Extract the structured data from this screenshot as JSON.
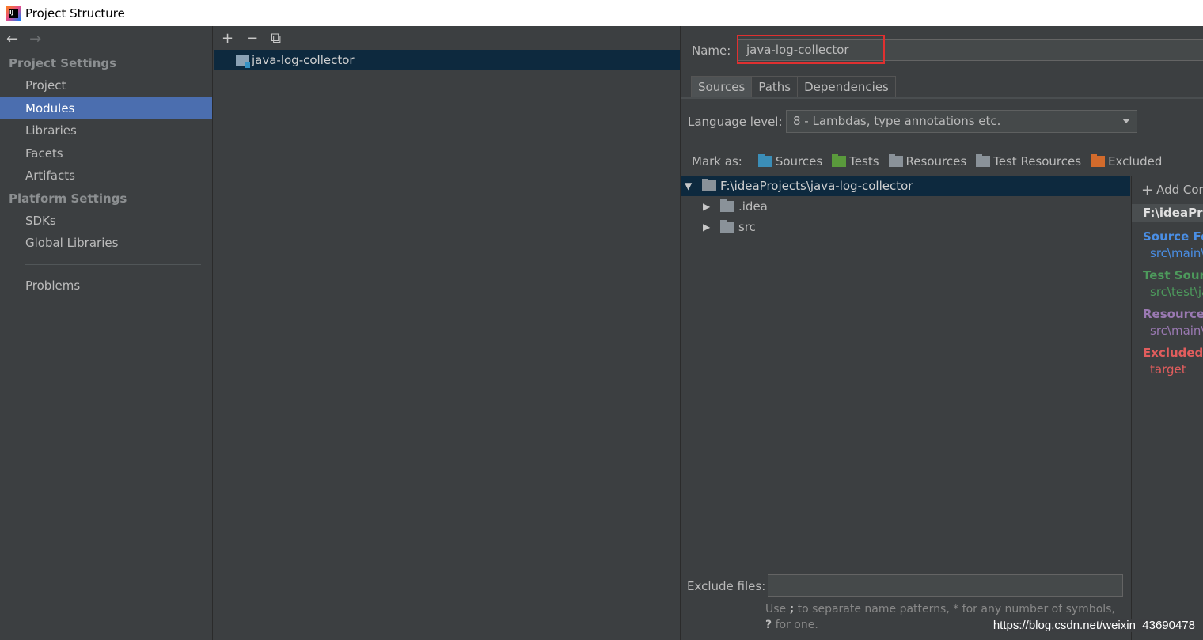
{
  "window": {
    "title": "Project Structure",
    "app_icon": "intellij-icon"
  },
  "sidebar": {
    "back_icon": "←",
    "forward_icon": "→",
    "project_settings_header": "Project Settings",
    "project_items": [
      "Project",
      "Modules",
      "Libraries",
      "Facets",
      "Artifacts"
    ],
    "selected": "Modules",
    "platform_settings_header": "Platform Settings",
    "platform_items": [
      "SDKs",
      "Global Libraries"
    ],
    "problems": "Problems"
  },
  "module_list": {
    "toolbar": {
      "add": "+",
      "remove": "−",
      "copy": "⧉"
    },
    "modules": [
      "java-log-collector"
    ]
  },
  "module_detail": {
    "name_label": "Name:",
    "name_value": "java-log-collector",
    "tabs": [
      "Sources",
      "Paths",
      "Dependencies"
    ],
    "active_tab": "Sources",
    "language_level_label": "Language level:",
    "language_level_value": "8 - Lambdas, type annotations etc.",
    "mark_as_label": "Mark as:",
    "mark_as": [
      {
        "label": "Sources",
        "color": "#3b8eb8"
      },
      {
        "label": "Tests",
        "color": "#5a9a3c"
      },
      {
        "label": "Resources",
        "color": "#8a9299"
      },
      {
        "label": "Test Resources",
        "color": "#8a9299"
      },
      {
        "label": "Excluded",
        "color": "#d36b2c"
      }
    ],
    "tree": {
      "root": "F:\\ideaProjects\\java-log-collector",
      "children": [
        ".idea",
        "src"
      ]
    },
    "content_roots": {
      "add_label": "Add Content Root",
      "root_path": "F:\\ideaProjects\\java-log-collector",
      "source_header": "Source Folders",
      "source_value": "src\\main\\java",
      "test_header": "Test Source Folders",
      "test_value": "src\\test\\java",
      "resource_header": "Resource Folders",
      "resource_value": "src\\main\\resources",
      "excluded_header": "Excluded Folders",
      "excluded_value": "target"
    },
    "exclude_files_label": "Exclude files:",
    "exclude_files_value": "",
    "hint_part1": "Use ",
    "hint_semicolon": ";",
    "hint_part2": " to separate name patterns, * for any number of symbols,",
    "hint_question": "?",
    "hint_part3": " for one."
  },
  "watermark": "https://blog.csdn.net/weixin_43690478"
}
